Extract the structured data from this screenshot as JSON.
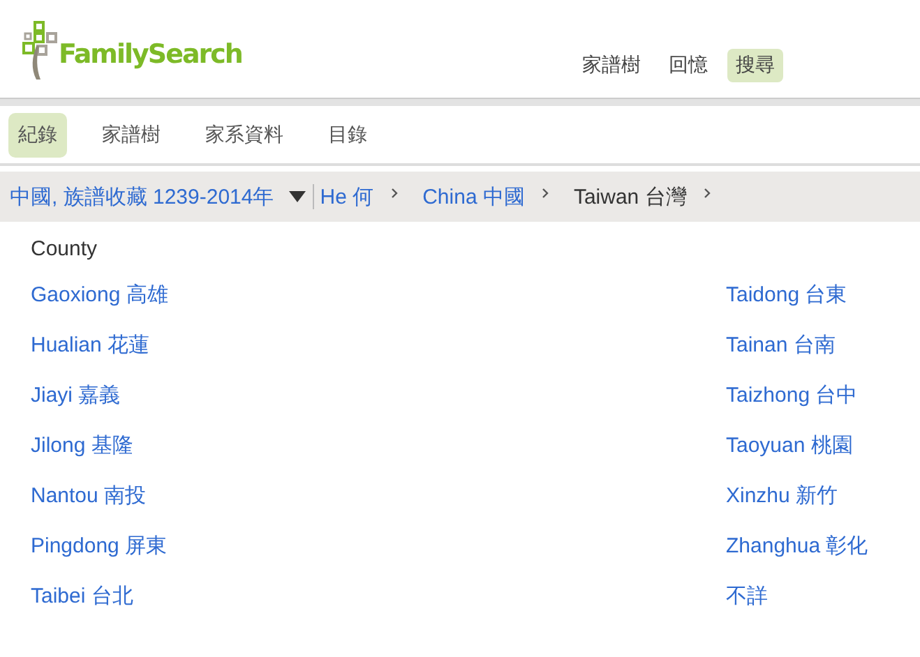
{
  "logo": {
    "text": "FamilySearch"
  },
  "top_nav": [
    {
      "label": "家譜樹",
      "selected": false
    },
    {
      "label": "回憶",
      "selected": false
    },
    {
      "label": "搜尋",
      "selected": true
    }
  ],
  "sub_nav": [
    {
      "label": "紀錄",
      "selected": true
    },
    {
      "label": "家譜樹",
      "selected": false
    },
    {
      "label": "家系資料",
      "selected": false
    },
    {
      "label": "目錄",
      "selected": false
    }
  ],
  "breadcrumb": [
    {
      "kind": "collection",
      "label": "中國, 族譜收藏 1239-2014年"
    },
    {
      "kind": "link",
      "label": "He 何"
    },
    {
      "kind": "link",
      "label": "China 中國"
    },
    {
      "kind": "current",
      "label": "Taiwan 台灣"
    }
  ],
  "list_heading": "County",
  "columns": [
    [
      "Gaoxiong 高雄",
      "Hualian 花蓮",
      "Jiayi 嘉義",
      "Jilong 基隆",
      "Nantou 南投",
      "Pingdong 屏東",
      "Taibei 台北"
    ],
    [
      "Taidong 台東",
      "Tainan 台南",
      "Taizhong 台中",
      "Taoyuan 桃園",
      "Xinzhu 新竹",
      "Zhanghua 彰化",
      "不詳"
    ]
  ]
}
